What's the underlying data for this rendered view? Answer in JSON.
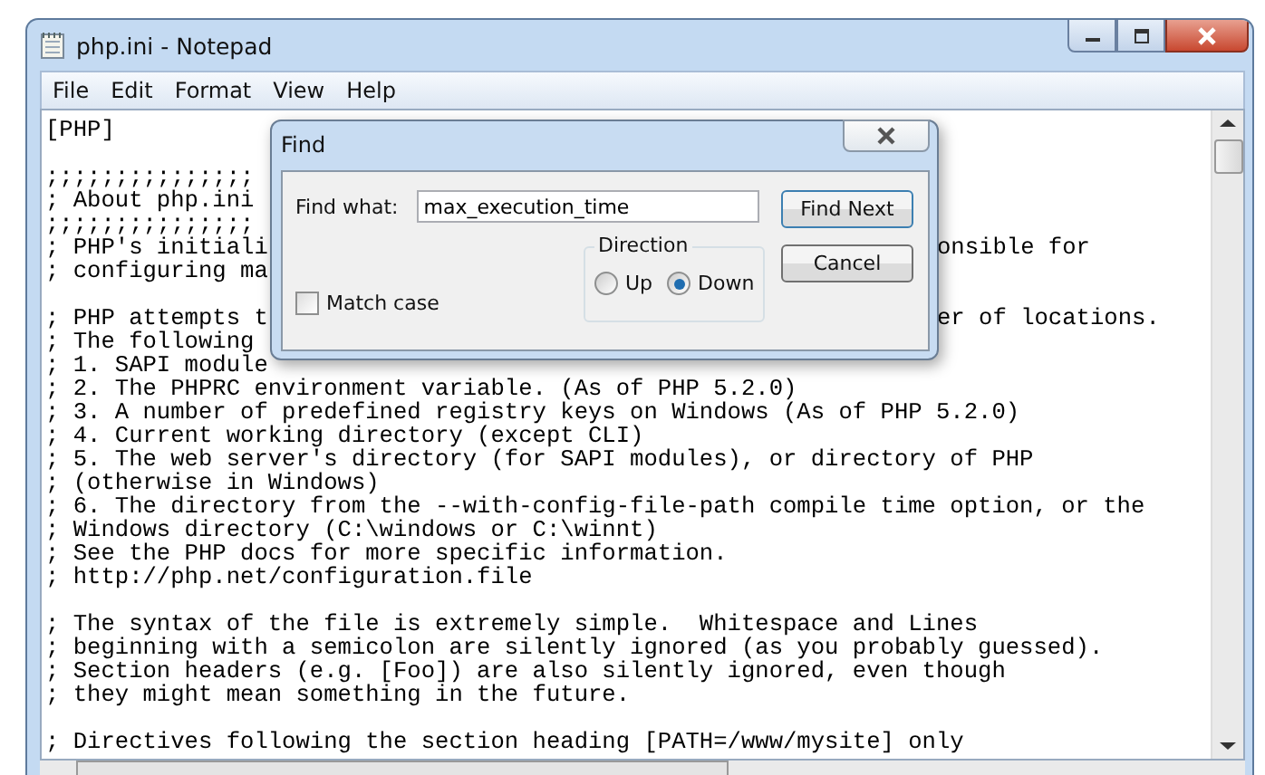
{
  "window": {
    "title": "php.ini - Notepad"
  },
  "menu": [
    "File",
    "Edit",
    "Format",
    "View",
    "Help"
  ],
  "editor": {
    "lines": [
      {
        "kind": "text",
        "text": "[PHP]"
      },
      {
        "kind": "blank"
      },
      {
        "kind": "text",
        "text": ";;;;;;;;;;;;;;;"
      },
      {
        "kind": "text",
        "text": "; About php.ini"
      },
      {
        "kind": "text",
        "text": ";;;;;;;;;;;;;;;"
      },
      {
        "kind": "text",
        "text": "; PHP's initiali",
        "tail": "onsible for"
      },
      {
        "kind": "text",
        "text": "; configuring ma"
      },
      {
        "kind": "blank"
      },
      {
        "kind": "text",
        "text": "; PHP attempts t",
        "tail": "er of locations."
      },
      {
        "kind": "text",
        "text": "; The following"
      },
      {
        "kind": "text",
        "text": "; 1. SAPI module"
      },
      {
        "kind": "text",
        "text": "; 2. The PHPRC environment variable. (As of PHP 5.2.0)"
      },
      {
        "kind": "text",
        "text": "; 3. A number of predefined registry keys on Windows (As of PHP 5.2.0)"
      },
      {
        "kind": "text",
        "text": "; 4. Current working directory (except CLI)"
      },
      {
        "kind": "text",
        "text": "; 5. The web server's directory (for SAPI modules), or directory of PHP"
      },
      {
        "kind": "text",
        "text": "; (otherwise in Windows)"
      },
      {
        "kind": "text",
        "text": "; 6. The directory from the --with-config-file-path compile time option, or the"
      },
      {
        "kind": "text",
        "text": "; Windows directory (C:\\windows or C:\\winnt)"
      },
      {
        "kind": "text",
        "text": "; See the PHP docs for more specific information."
      },
      {
        "kind": "text",
        "text": "; http://php.net/configuration.file"
      },
      {
        "kind": "blank"
      },
      {
        "kind": "text",
        "text": "; The syntax of the file is extremely simple.  Whitespace and Lines"
      },
      {
        "kind": "text",
        "text": "; beginning with a semicolon are silently ignored (as you probably guessed)."
      },
      {
        "kind": "text",
        "text": "; Section headers (e.g. [Foo]) are also silently ignored, even though"
      },
      {
        "kind": "text",
        "text": "; they might mean something in the future."
      },
      {
        "kind": "blank"
      },
      {
        "kind": "text",
        "text": "; Directives following the section heading [PATH=/www/mysite] only"
      }
    ]
  },
  "find_dialog": {
    "title": "Find",
    "find_what_label": "Find what:",
    "find_what_value": "max_execution_time",
    "find_next": "Find Next",
    "cancel": "Cancel",
    "match_case": {
      "label": "Match case",
      "checked": false
    },
    "direction": {
      "label": "Direction",
      "options": [
        {
          "label": "Up",
          "selected": false
        },
        {
          "label": "Down",
          "selected": true
        }
      ]
    }
  }
}
